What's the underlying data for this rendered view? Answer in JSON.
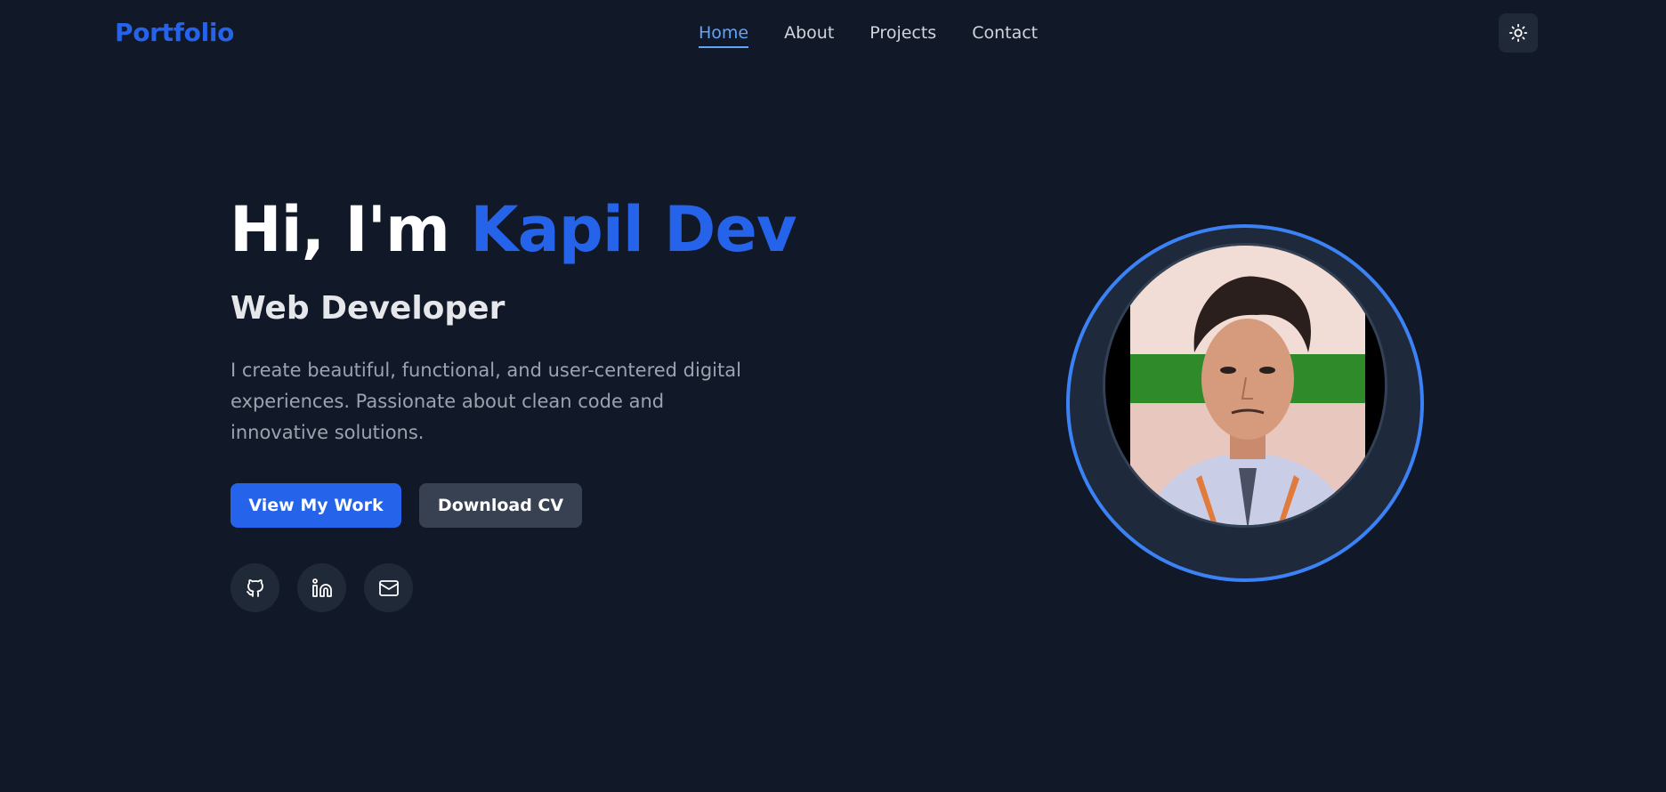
{
  "header": {
    "logo": "Portfolio",
    "nav": [
      {
        "label": "Home",
        "active": true
      },
      {
        "label": "About",
        "active": false
      },
      {
        "label": "Projects",
        "active": false
      },
      {
        "label": "Contact",
        "active": false
      }
    ],
    "theme_toggle_icon": "sun-icon"
  },
  "hero": {
    "greeting": "Hi, I'm ",
    "name": "Kapil Dev",
    "role": "Web Developer",
    "description": "I create beautiful, functional, and user-centered digital experiences. Passionate about clean code and innovative solutions.",
    "primary_button": "View My Work",
    "secondary_button": "Download CV",
    "socials": [
      {
        "icon": "github-icon"
      },
      {
        "icon": "linkedin-icon"
      },
      {
        "icon": "mail-icon"
      }
    ]
  },
  "avatar": {
    "icon": "profile-photo"
  },
  "colors": {
    "background": "#111828",
    "accent": "#2563eb",
    "nav_active": "#60a5fa",
    "secondary_button": "#374151",
    "ring": "#3b82f6"
  }
}
